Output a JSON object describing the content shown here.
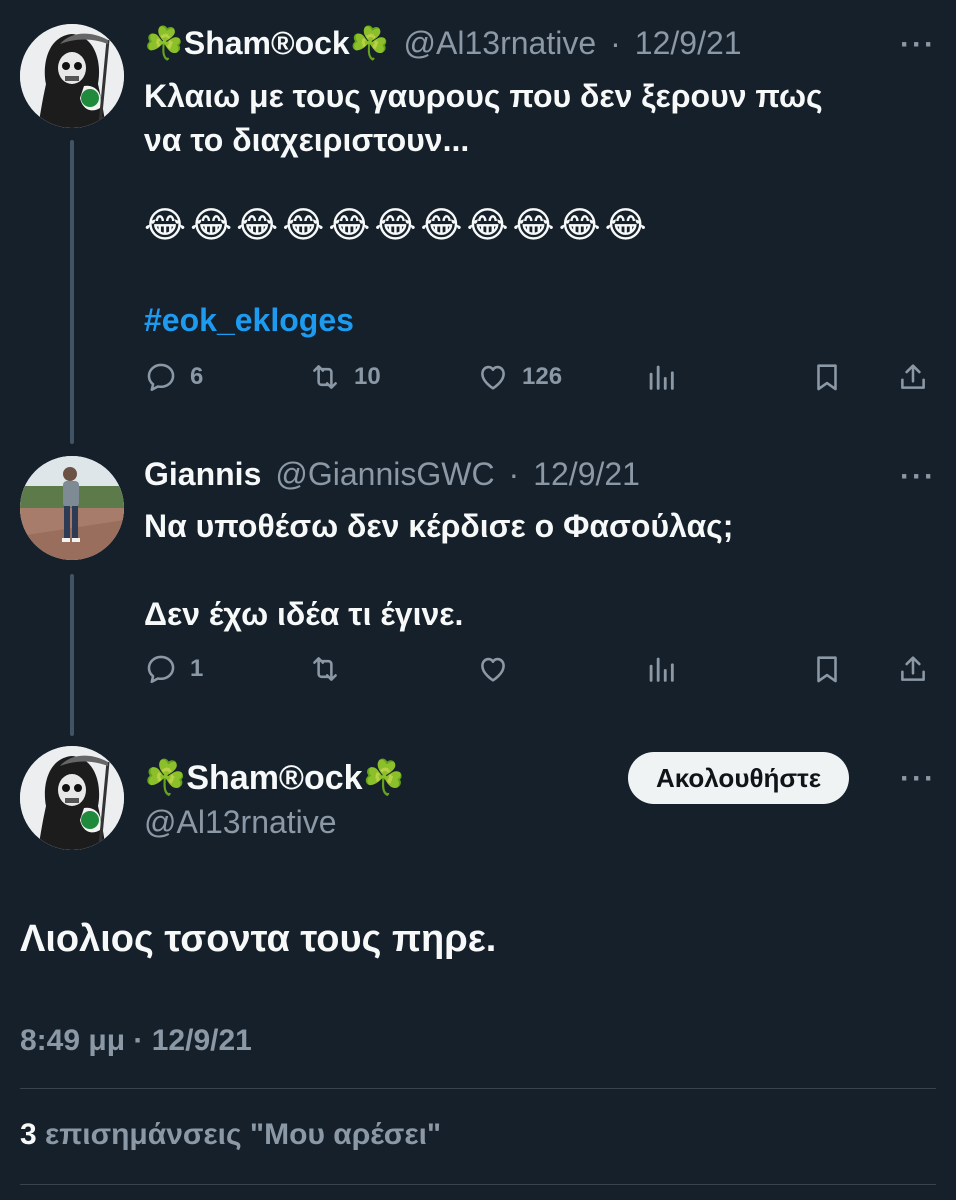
{
  "tweets": [
    {
      "display_name": "☘️Sham®ock☘️",
      "handle": "@Al13rnative",
      "date": "12/9/21",
      "text_line1": "Κλαιω με τους γαυρους που δεν ξερουν πως",
      "text_line2": "να το διαχειριστουν...",
      "emojis": "😂😂😂😂😂😂😂😂😂😂😂",
      "hashtag": "#eok_ekloges",
      "replies": "6",
      "retweets": "10",
      "likes": "126",
      "more": "···"
    },
    {
      "display_name": "Giannis",
      "handle": "@GiannisGWC",
      "date": "12/9/21",
      "text_line1": "Να υποθέσω δεν κέρδισε ο Φασούλας;",
      "text_line2": "Δεν έχω ιδέα τι έγινε.",
      "replies": "1",
      "more": "···"
    }
  ],
  "main_tweet": {
    "display_name": "☘️Sham®ock☘️",
    "handle": "@Al13rnative",
    "follow_label": "Ακολουθήστε",
    "more": "···",
    "text": "Λιολιος τσοντα τους πηρε.",
    "timestamp": "8:49 μμ · 12/9/21",
    "likes_count": "3",
    "likes_label": "επισημάνσεις \"Μου αρέσει\""
  },
  "colors": {
    "background": "#15202b",
    "text": "#f7f9f9",
    "secondary": "#8b98a5",
    "link": "#1d9bf0",
    "divider": "#38444d"
  },
  "icons": [
    "reply-icon",
    "retweet-icon",
    "like-icon",
    "views-icon",
    "bookmark-icon",
    "share-icon",
    "more-icon"
  ]
}
